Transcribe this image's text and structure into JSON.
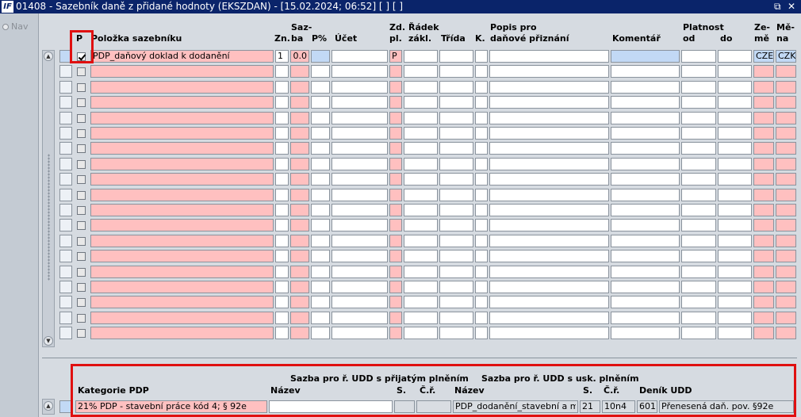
{
  "window": {
    "title": "01408 - Sazebník daně z přidané hodnoty (EKSZDAN) - [15.02.2024; 06:52]  [ ]  [ ]",
    "icon_text": "IF",
    "restore_icon": "⧉",
    "close_icon": "✕"
  },
  "nav": {
    "label": "Nav"
  },
  "columns": {
    "p": "P",
    "polozka": "Položka sazebníku",
    "zn": "Zn.",
    "sazba_top": "Saz-",
    "sazba_bot": "ba",
    "p_pct": "P%",
    "ucet": "Účet",
    "zd_top": "Zd.",
    "zd_bot": "pl.",
    "radek_top": "Řádek",
    "radek_bot": "zákl.",
    "trida": "Třída",
    "k": "K.",
    "popis_top": "Popis pro",
    "popis_bot": "daňové přiznání",
    "komentar": "Komentář",
    "platnost": "Platnost",
    "od": "od",
    "do": "do",
    "zeme_top": "Ze-",
    "zeme_bot": "mě",
    "mena_top": "Mě-",
    "mena_bot": "na"
  },
  "first_row": {
    "polozka": "PDP_daňový doklad k dodanění",
    "zn": "1",
    "sazba": "0.0",
    "zd": "P",
    "zeme": "CZE",
    "mena": "CZK"
  },
  "bottom": {
    "sazba_prijate": "Sazba pro ř. UDD s přijatým plněním",
    "sazba_usk": "Sazba pro ř. UDD s usk. plněním",
    "kategorie_label": "Kategorie PDP",
    "nazev1_label": "Název",
    "s1_label": "S.",
    "cr1_label": "Č.ř.",
    "nazev2_label": "Název",
    "s2_label": "S.",
    "cr2_label": "Č.ř.",
    "denik_label": "Deník UDD",
    "kategorie_value": "21% PDP - stavební práce kód 4; § 92e",
    "nazev1_value": "",
    "nazev2_value": "PDP_dodanění_stavební a montá",
    "s2_value": "21",
    "cr2_value": "10n4",
    "denik_code": "601",
    "denik_value": "Přenesená daň. pov. §92e"
  },
  "colors": {
    "title_bar": "#0a246a",
    "required_field": "#ffc0c0",
    "current_field": "#c2d9f5",
    "highlight": "#e01010"
  }
}
